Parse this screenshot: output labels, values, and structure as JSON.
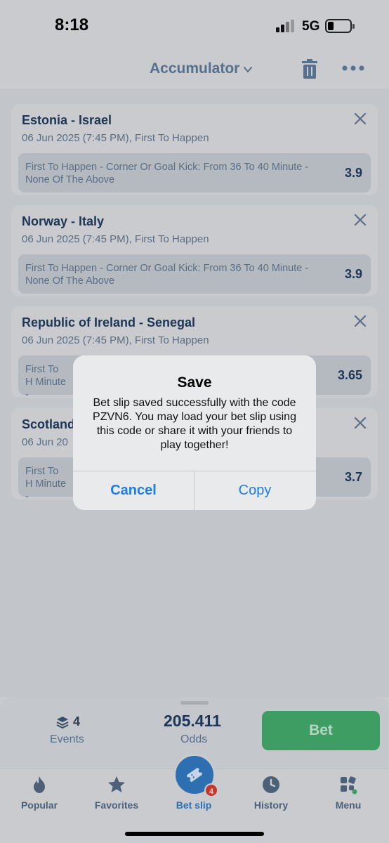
{
  "status_bar": {
    "time": "8:18",
    "network": "5G"
  },
  "header": {
    "title": "Accumulator"
  },
  "bets": [
    {
      "match": "Estonia - Israel",
      "info": "06 Jun 2025 (7:45 PM), First To Happen",
      "selection": "First To Happen - Corner Or Goal Kick: From 36 To 40 Minute - None Of The Above",
      "odds": "3.9"
    },
    {
      "match": "Norway - Italy",
      "info": "06 Jun 2025 (7:45 PM), First To Happen",
      "selection": "First To Happen - Corner Or Goal Kick: From 36 To 40 Minute - None Of The Above",
      "odds": "3.9"
    },
    {
      "match": "Republic of Ireland - Senegal",
      "info": "06 Jun 2025 (7:45 PM), First To Happen",
      "selection": "First To H Minute -",
      "odds": "3.65"
    },
    {
      "match": "Scotland",
      "info": "06 Jun 20",
      "selection": "First To H Minute -",
      "odds": "3.7"
    }
  ],
  "dialog": {
    "title": "Save",
    "message": "Bet slip saved successfully with the code PZVN6. You may load your bet slip using this code or share it with your friends to play together!",
    "cancel_label": "Cancel",
    "copy_label": "Copy"
  },
  "summary": {
    "events_count": "4",
    "events_label": "Events",
    "odds_value": "205.411",
    "odds_label": "Odds",
    "bet_label": "Bet"
  },
  "tabbar": {
    "items": [
      {
        "label": "Popular",
        "icon": "flame-icon"
      },
      {
        "label": "Favorites",
        "icon": "star-icon"
      },
      {
        "label": "Bet slip",
        "icon": "ticket-icon"
      },
      {
        "label": "History",
        "icon": "clock-icon"
      },
      {
        "label": "Menu",
        "icon": "grid-icon"
      }
    ],
    "betslip_badge": "4"
  },
  "colors": {
    "accent": "#2d6fb0",
    "bet_green": "#3e9d63",
    "dialog_button": "#1b7ee0"
  }
}
